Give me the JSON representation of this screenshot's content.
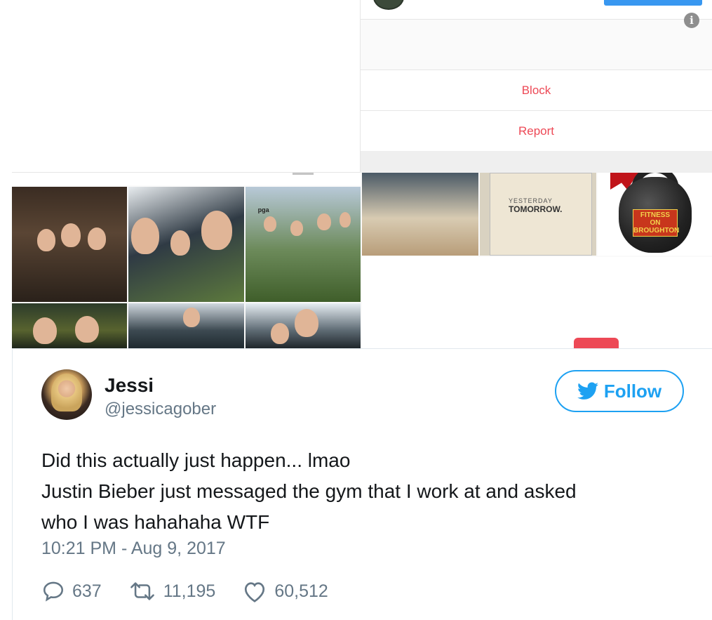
{
  "instagram": {
    "menu": [
      "Block",
      "Report"
    ],
    "info_icon": "info-icon",
    "grid_label": "pga",
    "poster": {
      "line1": "YESTERDAY",
      "line2": "TOMORROW."
    },
    "kettlebell_label": [
      "FITNESS",
      "ON",
      "BROUGHTON"
    ]
  },
  "tweet": {
    "name": "Jessi",
    "handle": "@jessicagober",
    "follow_label": "Follow",
    "text_lines": [
      "Did this actually just happen... lmao",
      "Justin Bieber just messaged the gym that I work at and asked",
      "who I was hahahaha WTF"
    ],
    "timestamp": "10:21 PM - Aug 9, 2017",
    "replies": "637",
    "retweets": "11,195",
    "likes": "60,512"
  },
  "colors": {
    "twitter_blue": "#1da1f2",
    "instagram_red": "#ed4956",
    "secondary_text": "#657786"
  },
  "icons": [
    "reply-icon",
    "retweet-icon",
    "like-icon",
    "twitter-bird-icon",
    "info-icon"
  ]
}
